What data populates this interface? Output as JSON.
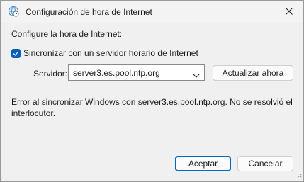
{
  "window": {
    "title": "Configuración de hora de Internet",
    "icon": "clock-globe-icon",
    "close_icon": "close-icon"
  },
  "content": {
    "heading": "Configure la hora de Internet:",
    "sync_checkbox": {
      "label": "Sincronizar con un servidor horario de Internet",
      "checked": true
    },
    "server": {
      "label": "Servidor:",
      "value": "server3.es.pool.ntp.org"
    },
    "update_button": "Actualizar ahora",
    "error_message": "Error al sincronizar Windows con server3.es.pool.ntp.org.  No se resolvió el interlocutor."
  },
  "footer": {
    "accept_button": "Aceptar",
    "cancel_button": "Cancelar"
  },
  "colors": {
    "accent": "#005fb8",
    "window_bg": "#f0f0f0"
  }
}
